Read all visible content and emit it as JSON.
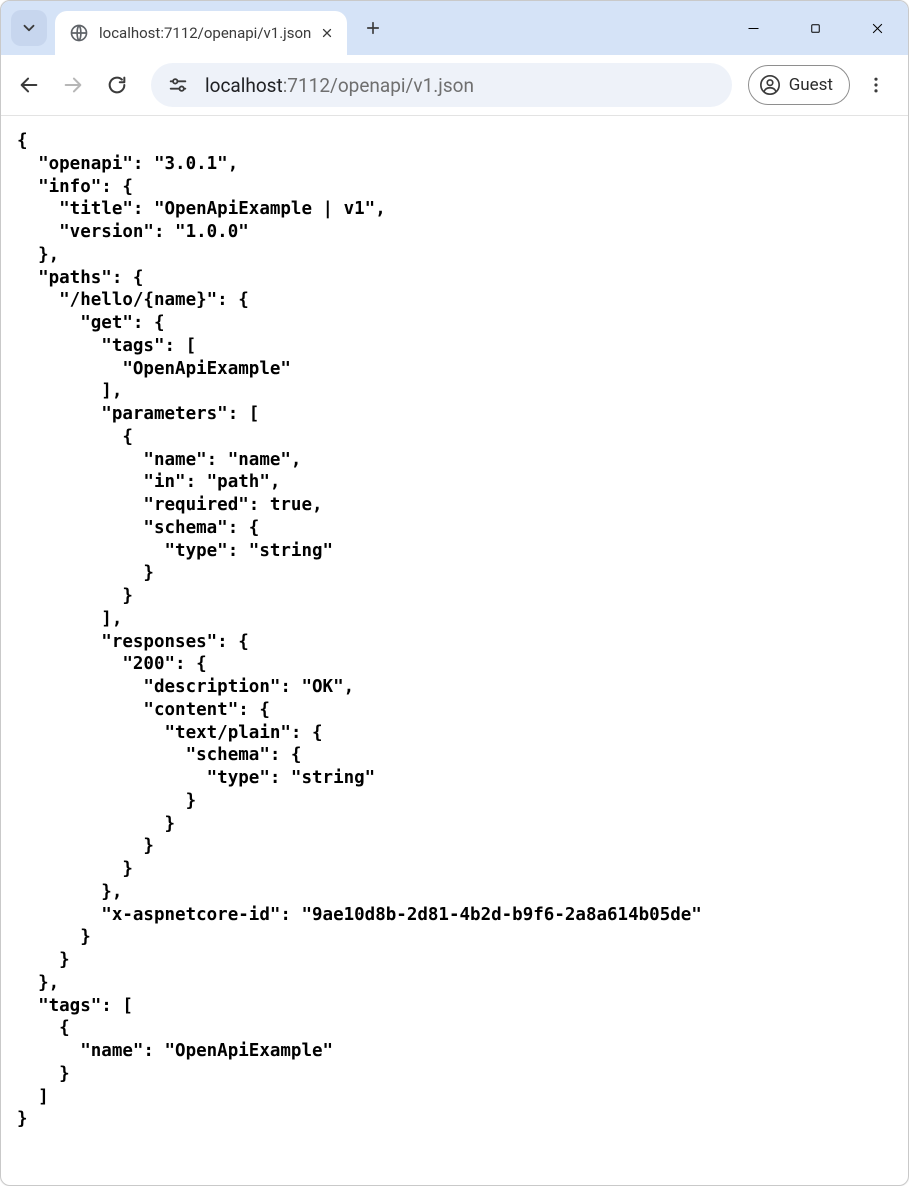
{
  "tab": {
    "title": "localhost:7112/openapi/v1.json"
  },
  "addressbar": {
    "host": "localhost",
    "rest": ":7112/openapi/v1.json"
  },
  "profile": {
    "label": "Guest"
  },
  "json_body": "{\n  \"openapi\": \"3.0.1\",\n  \"info\": {\n    \"title\": \"OpenApiExample | v1\",\n    \"version\": \"1.0.0\"\n  },\n  \"paths\": {\n    \"/hello/{name}\": {\n      \"get\": {\n        \"tags\": [\n          \"OpenApiExample\"\n        ],\n        \"parameters\": [\n          {\n            \"name\": \"name\",\n            \"in\": \"path\",\n            \"required\": true,\n            \"schema\": {\n              \"type\": \"string\"\n            }\n          }\n        ],\n        \"responses\": {\n          \"200\": {\n            \"description\": \"OK\",\n            \"content\": {\n              \"text/plain\": {\n                \"schema\": {\n                  \"type\": \"string\"\n                }\n              }\n            }\n          }\n        },\n        \"x-aspnetcore-id\": \"9ae10d8b-2d81-4b2d-b9f6-2a8a614b05de\"\n      }\n    }\n  },\n  \"tags\": [\n    {\n      \"name\": \"OpenApiExample\"\n    }\n  ]\n}"
}
